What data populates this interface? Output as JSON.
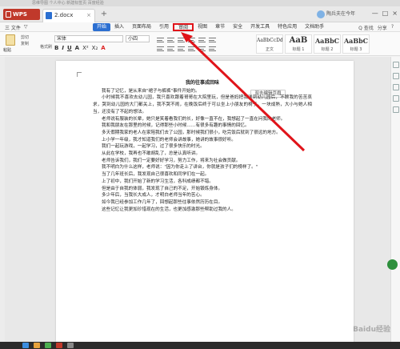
{
  "browser_strip": {
    "text": "思维导图 个人中心 新建标签页 百度经验"
  },
  "titlebar": {
    "app_tab": "WPS",
    "doc_tab": "2.docx",
    "new_tab_symbol": "+",
    "user_name": "陶兵夫在今年",
    "window_controls": [
      "—",
      "□",
      "×"
    ]
  },
  "menubar": {
    "left": [
      "三 文件",
      "▽"
    ],
    "items": [
      "开始",
      "插入",
      "页面布局",
      "引用",
      "审阅",
      "视图",
      "章节",
      "安全",
      "开发工具",
      "特色应用",
      "文档助手"
    ],
    "active": "开始",
    "highlighted": "审阅",
    "right": [
      "Q 查找",
      "分享",
      "?"
    ]
  },
  "ribbon": {
    "paste_label": "粘贴",
    "cut_label": "剪切",
    "copy_label": "复制",
    "format_brush_label": "格式刷",
    "font_name": "宋体",
    "font_size": "小四",
    "font_tools": [
      "B",
      "I",
      "U",
      "A",
      "X²",
      "X₂",
      "A"
    ],
    "styles": [
      {
        "sample": "AaBbCcDd",
        "name": "正文"
      },
      {
        "sample": "AaB",
        "name": "标题 1"
      },
      {
        "sample": "AaBbC",
        "name": "标题 2"
      },
      {
        "sample": "AaBbC",
        "name": "标题 3"
      }
    ]
  },
  "document": {
    "dual_page_button": "双击编辑页眉",
    "title": "我的往事成回味",
    "paragraphs": [
      "我有了记忆，是从来自\"裙子与裤裤\"事件开始的。",
      "小时候我不喜欢去幼儿园，我只喜欢跟着哥哥在大院里玩，但是爸妈把我送到幼儿园后，不顾我的苦苦哀求，哭到幼儿园的大门都关上，我不哭不闹，在晚饭后终于可以坐上小朋友的椅子，一块成熟，大小与她人相当，还没有了不起的想法。",
      "老师说有服装的长辈，她只是笑着看我们的长，好像一直不在，我想起了一直在问我的老师。",
      "我和我朋友在那里的时候，记得那些小时候……有很多有趣的事情的回忆。",
      "多天假期我家的老人在家陪我们去了公园，那时候我们很小，吃完饭后就到了很远的地方。",
      "上小学一年级，我才知道我们的老师会讲故事，她讲的故事很好听。",
      "我们一起玩游戏，一起学习，过了很多快乐的时光。",
      "从此在学校，我再也不敢胡乱了，总是认真听讲。",
      "老师告诉我们，我们一定要好好学习，努力工作，将来为社会做贡献。",
      "我不明白为什么这样，老师说：\"因为你走上了讲台，你就是孩子们的榜样了。\"",
      "当了几年班长后，我发现自己很喜欢和同学们在一起。",
      "上了初中，我们开始了新的学习生活，各科成绩都不错。",
      "但是由于自我的体弱，我发现了自己的不足，开始锻炼身体。",
      "多少年后，当我长大成人，才明白老师当年的苦心。",
      "如今我已经参加工作几年了，回想起那些往事依然历历在目。",
      "这些记忆让我更加珍惜现在的生活，也更加感激那些帮助过我的人。"
    ]
  },
  "watermark": "Baidu经验",
  "colors": {
    "accent_blue": "#2c6fd1",
    "wps_red": "#c0392b",
    "highlight_red": "#e0141a"
  }
}
